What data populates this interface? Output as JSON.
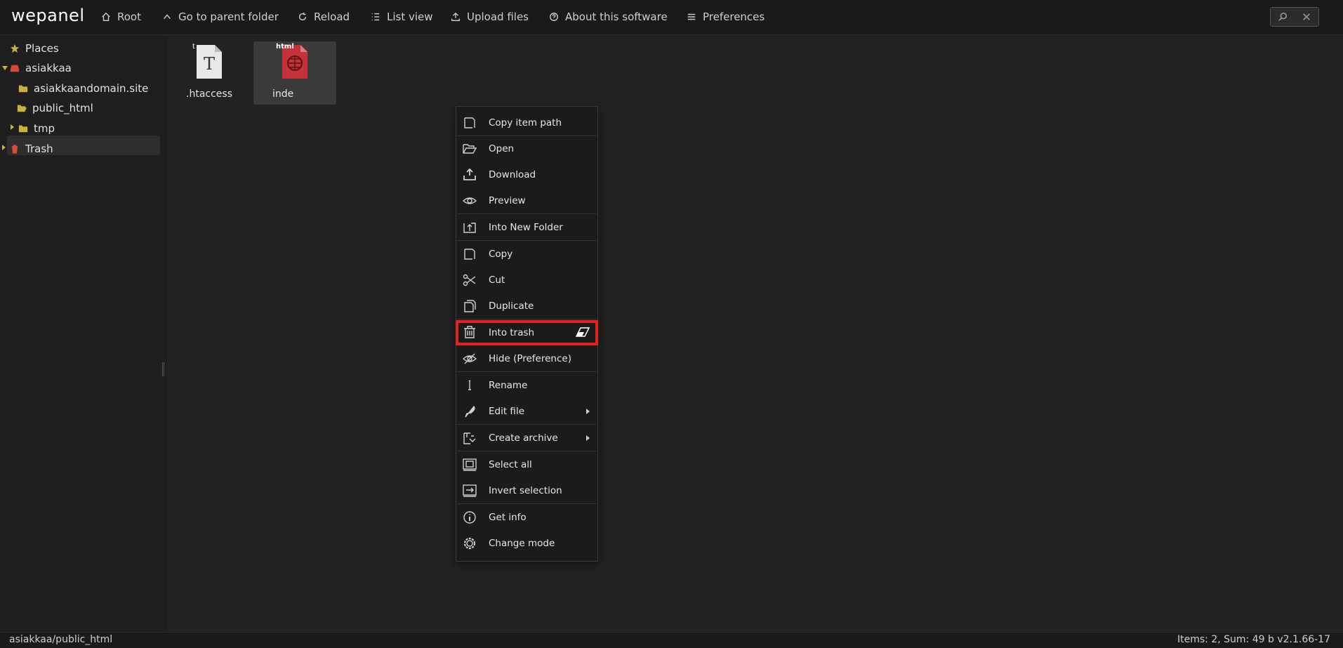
{
  "app": {
    "logo": "wepanel"
  },
  "toolbar": {
    "root": "Root",
    "parent": "Go to parent folder",
    "reload": "Reload",
    "list_view": "List view",
    "upload": "Upload files",
    "about": "About this software",
    "preferences": "Preferences"
  },
  "tree": {
    "places": "Places",
    "asiakkaa": "asiakkaa",
    "domain": "asiakkaandomain.site",
    "public_html": "public_html",
    "tmp": "tmp",
    "trash": "Trash"
  },
  "files": [
    {
      "name": ".htaccess",
      "badge": "t"
    },
    {
      "name": "inde",
      "badge": "html"
    }
  ],
  "menu": {
    "items": [
      "Copy item path",
      "Open",
      "Download",
      "Preview",
      "Into New Folder",
      "Copy",
      "Cut",
      "Duplicate",
      "Into trash",
      "Hide (Preference)",
      "Rename",
      "Edit file",
      "Create archive",
      "Select all",
      "Invert selection",
      "Get info",
      "Change mode"
    ]
  },
  "status": {
    "path": "asiakkaa/public_html",
    "info": "Items: 2, Sum: 49 b  v2.1.66-17"
  },
  "colors": {
    "highlight": "#e0241b",
    "folder": "#c9b23c",
    "trash": "#d94a3f",
    "drive": "#d14a3c"
  }
}
